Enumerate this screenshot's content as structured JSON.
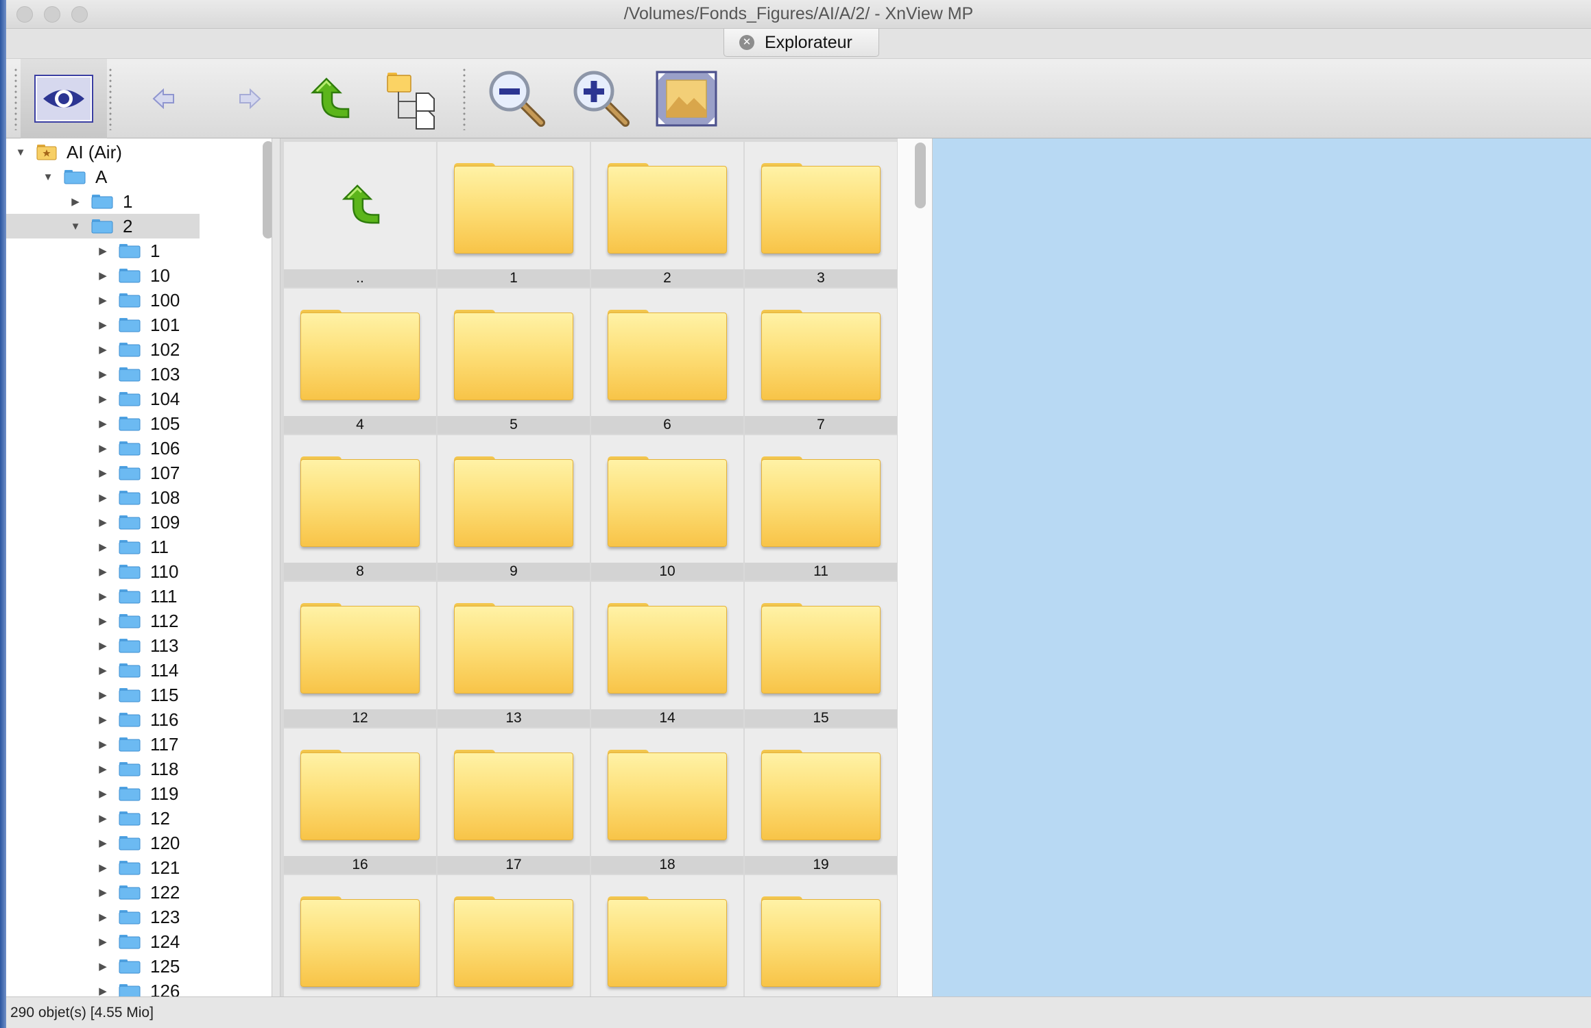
{
  "window": {
    "title": "/Volumes/Fonds_Figures/AI/A/2/ - XnView MP"
  },
  "tabs": [
    {
      "label": "Explorateur",
      "close_icon": "close-circle-icon"
    }
  ],
  "toolbar": {
    "buttons": [
      {
        "name": "view-toggle",
        "icon": "eye-icon",
        "state": "pressed"
      },
      {
        "name": "back",
        "icon": "left-arrow-icon",
        "state": "disabled"
      },
      {
        "name": "forward",
        "icon": "right-arrow-icon",
        "state": "disabled"
      },
      {
        "name": "parent-folder",
        "icon": "up-arrow-green-icon"
      },
      {
        "name": "folder-tree",
        "icon": "folder-tree-icon"
      },
      {
        "name": "zoom-out",
        "icon": "zoom-out-icon"
      },
      {
        "name": "zoom-in",
        "icon": "zoom-in-icon"
      },
      {
        "name": "fit-image",
        "icon": "fit-image-icon"
      }
    ]
  },
  "tree": {
    "root": {
      "label": "AI (Air)",
      "expanded": true
    },
    "level1": {
      "label": "A",
      "expanded": true
    },
    "level2": [
      {
        "label": "1",
        "expanded": false
      },
      {
        "label": "2",
        "expanded": true,
        "selected": true
      }
    ],
    "children": [
      "1",
      "10",
      "100",
      "101",
      "102",
      "103",
      "104",
      "105",
      "106",
      "107",
      "108",
      "109",
      "11",
      "110",
      "111",
      "112",
      "113",
      "114",
      "115",
      "116",
      "117",
      "118",
      "119",
      "12",
      "120",
      "121",
      "122",
      "123",
      "124",
      "125",
      "126"
    ]
  },
  "grid": {
    "items": [
      {
        "label": "..",
        "type": "parent"
      },
      {
        "label": "1",
        "type": "folder"
      },
      {
        "label": "2",
        "type": "folder"
      },
      {
        "label": "3",
        "type": "folder"
      },
      {
        "label": "4",
        "type": "folder"
      },
      {
        "label": "5",
        "type": "folder"
      },
      {
        "label": "6",
        "type": "folder"
      },
      {
        "label": "7",
        "type": "folder"
      },
      {
        "label": "8",
        "type": "folder"
      },
      {
        "label": "9",
        "type": "folder"
      },
      {
        "label": "10",
        "type": "folder"
      },
      {
        "label": "11",
        "type": "folder"
      },
      {
        "label": "12",
        "type": "folder"
      },
      {
        "label": "13",
        "type": "folder"
      },
      {
        "label": "14",
        "type": "folder"
      },
      {
        "label": "15",
        "type": "folder"
      },
      {
        "label": "16",
        "type": "folder"
      },
      {
        "label": "17",
        "type": "folder"
      },
      {
        "label": "18",
        "type": "folder"
      },
      {
        "label": "19",
        "type": "folder"
      },
      {
        "label": "",
        "type": "folder"
      },
      {
        "label": "",
        "type": "folder"
      },
      {
        "label": "",
        "type": "folder"
      },
      {
        "label": "",
        "type": "folder"
      }
    ]
  },
  "status": {
    "text": "290 objet(s) [4.55 Mio]"
  },
  "colors": {
    "preview_bg": "#b8d9f3",
    "folder_yellow": "#fde07a",
    "tree_folder_blue": "#6cbaf2",
    "accent_navy": "#2c3592",
    "arrow_green": "#5cb51b"
  }
}
